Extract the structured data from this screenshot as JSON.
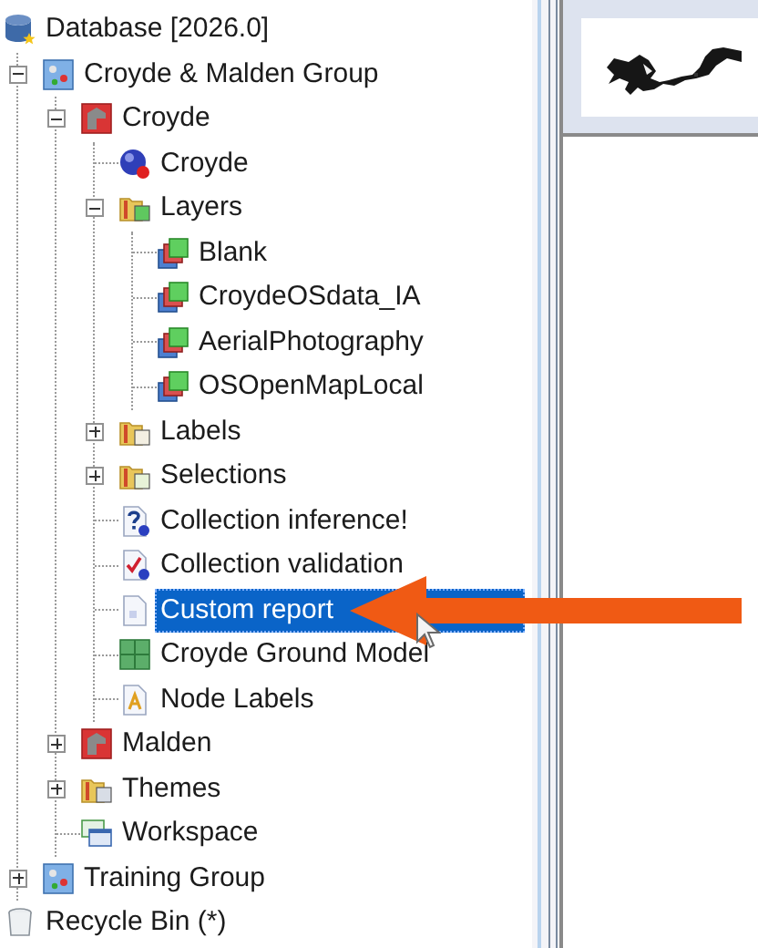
{
  "tree": [
    {
      "label": "Database [2026.0]",
      "kind": "database",
      "selected": false,
      "children": [
        {
          "label": "Croyde & Malden Group",
          "kind": "group",
          "expanded": true,
          "selected": false,
          "children": [
            {
              "label": "Croyde",
              "kind": "network",
              "expanded": true,
              "selected": false,
              "children": [
                {
                  "label": "Croyde",
                  "kind": "model",
                  "selected": false
                },
                {
                  "label": "Layers",
                  "kind": "layer-folder",
                  "expanded": true,
                  "selected": false,
                  "children": [
                    {
                      "label": "Blank",
                      "kind": "layer",
                      "selected": false
                    },
                    {
                      "label": "CroydeOSdata_IA",
                      "kind": "layer",
                      "selected": false
                    },
                    {
                      "label": "AerialPhotography",
                      "kind": "layer",
                      "selected": false
                    },
                    {
                      "label": "OSOpenMapLocal",
                      "kind": "layer",
                      "selected": false
                    }
                  ]
                },
                {
                  "label": "Labels",
                  "kind": "label-folder",
                  "expanded": false,
                  "selected": false
                },
                {
                  "label": "Selections",
                  "kind": "selection-folder",
                  "expanded": false,
                  "selected": false
                },
                {
                  "label": "Collection inference!",
                  "kind": "inference",
                  "selected": false
                },
                {
                  "label": "Collection validation",
                  "kind": "validation",
                  "selected": false
                },
                {
                  "label": "Custom report",
                  "kind": "report",
                  "selected": true
                },
                {
                  "label": "Croyde Ground Model",
                  "kind": "ground-model",
                  "selected": false
                },
                {
                  "label": "Node Labels",
                  "kind": "labels",
                  "selected": false
                }
              ]
            },
            {
              "label": "Malden",
              "kind": "network",
              "expanded": false,
              "selected": false
            },
            {
              "label": "Themes",
              "kind": "theme-folder",
              "expanded": false,
              "selected": false
            },
            {
              "label": "Workspace",
              "kind": "workspace",
              "selected": false
            }
          ]
        },
        {
          "label": "Training Group",
          "kind": "group",
          "expanded": false,
          "selected": false
        }
      ]
    },
    {
      "label": "Recycle Bin (*)",
      "kind": "recycle-bin",
      "selected": false
    }
  ]
}
